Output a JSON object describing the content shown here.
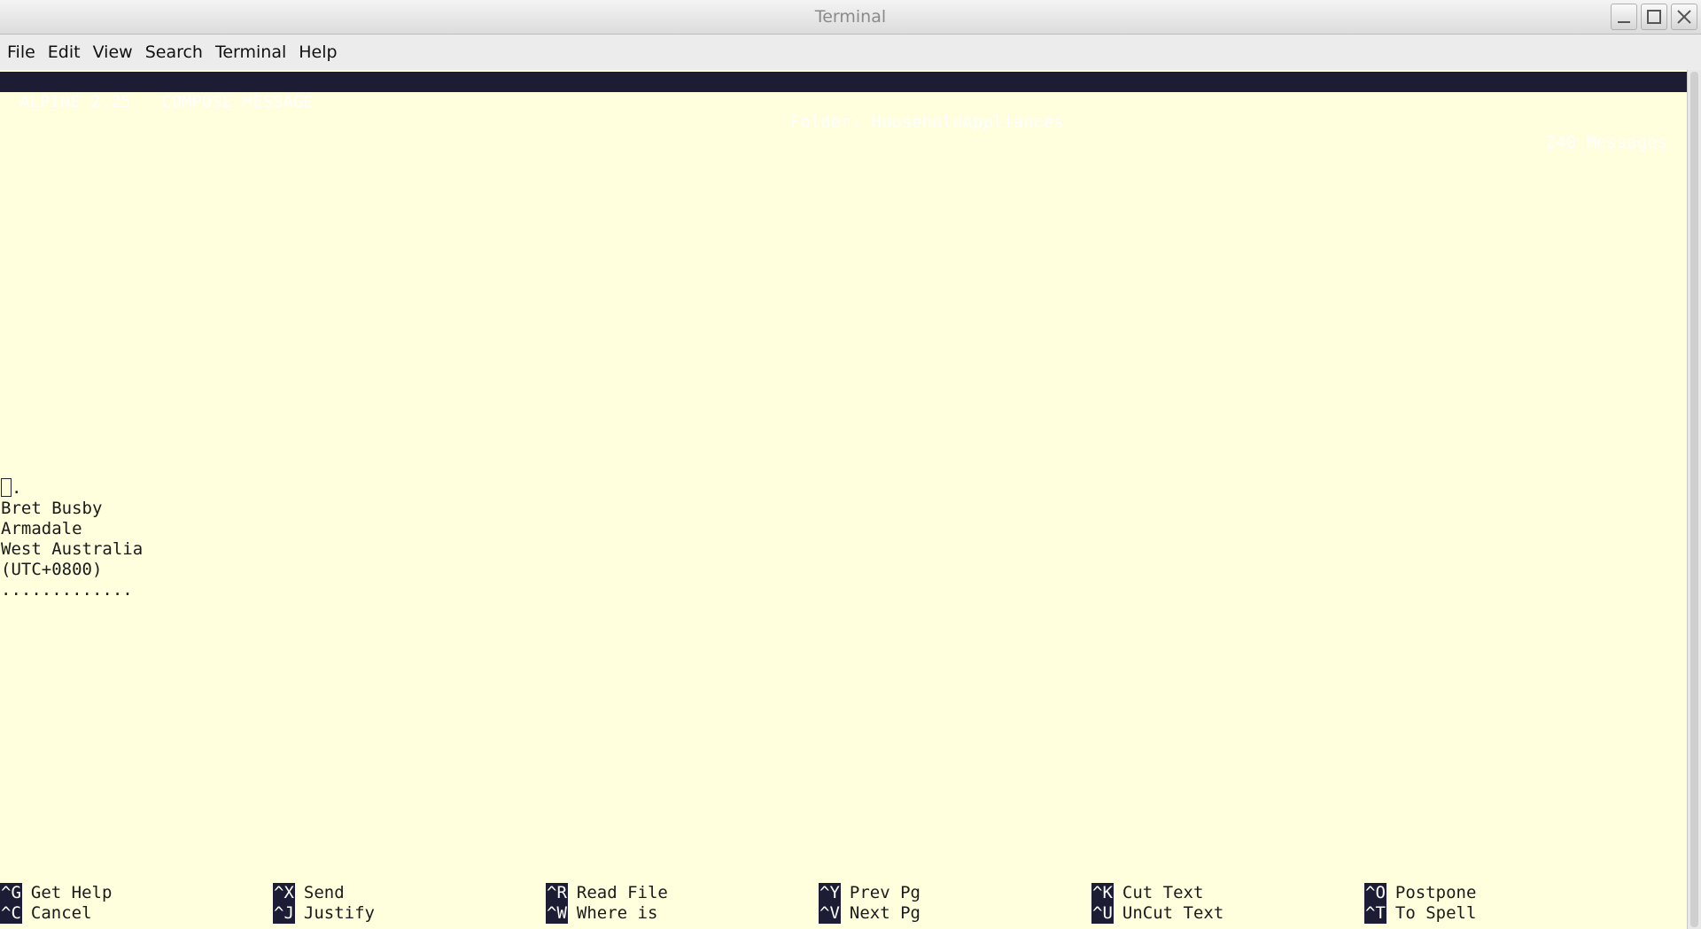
{
  "window": {
    "title": "Terminal"
  },
  "menu": [
    "File",
    "Edit",
    "View",
    "Search",
    "Terminal",
    "Help"
  ],
  "status": {
    "app": "ALPINE 2.25   COMPOSE MESSAGE",
    "folder": "Folder: HouseholdAppliances",
    "count": "240 Messages"
  },
  "body": {
    "cursor_line_rest": ".",
    "lines": [
      "Bret Busby",
      "Armadale",
      "West Australia",
      "(UTC+0800)",
      "............."
    ]
  },
  "keys": [
    {
      "key": "^G",
      "label": "Get Help"
    },
    {
      "key": "^X",
      "label": "Send"
    },
    {
      "key": "^R",
      "label": "Read File"
    },
    {
      "key": "^Y",
      "label": "Prev Pg"
    },
    {
      "key": "^K",
      "label": "Cut Text"
    },
    {
      "key": "^O",
      "label": "Postpone"
    },
    {
      "key": "^C",
      "label": "Cancel"
    },
    {
      "key": "^J",
      "label": "Justify"
    },
    {
      "key": "^W",
      "label": "Where is"
    },
    {
      "key": "^V",
      "label": "Next Pg"
    },
    {
      "key": "^U",
      "label": "UnCut Text"
    },
    {
      "key": "^T",
      "label": "To Spell"
    }
  ],
  "colors": {
    "terminal_bg": "#ffffdd",
    "status_bg": "#1c1c34",
    "status_fg": "#ffffff"
  }
}
